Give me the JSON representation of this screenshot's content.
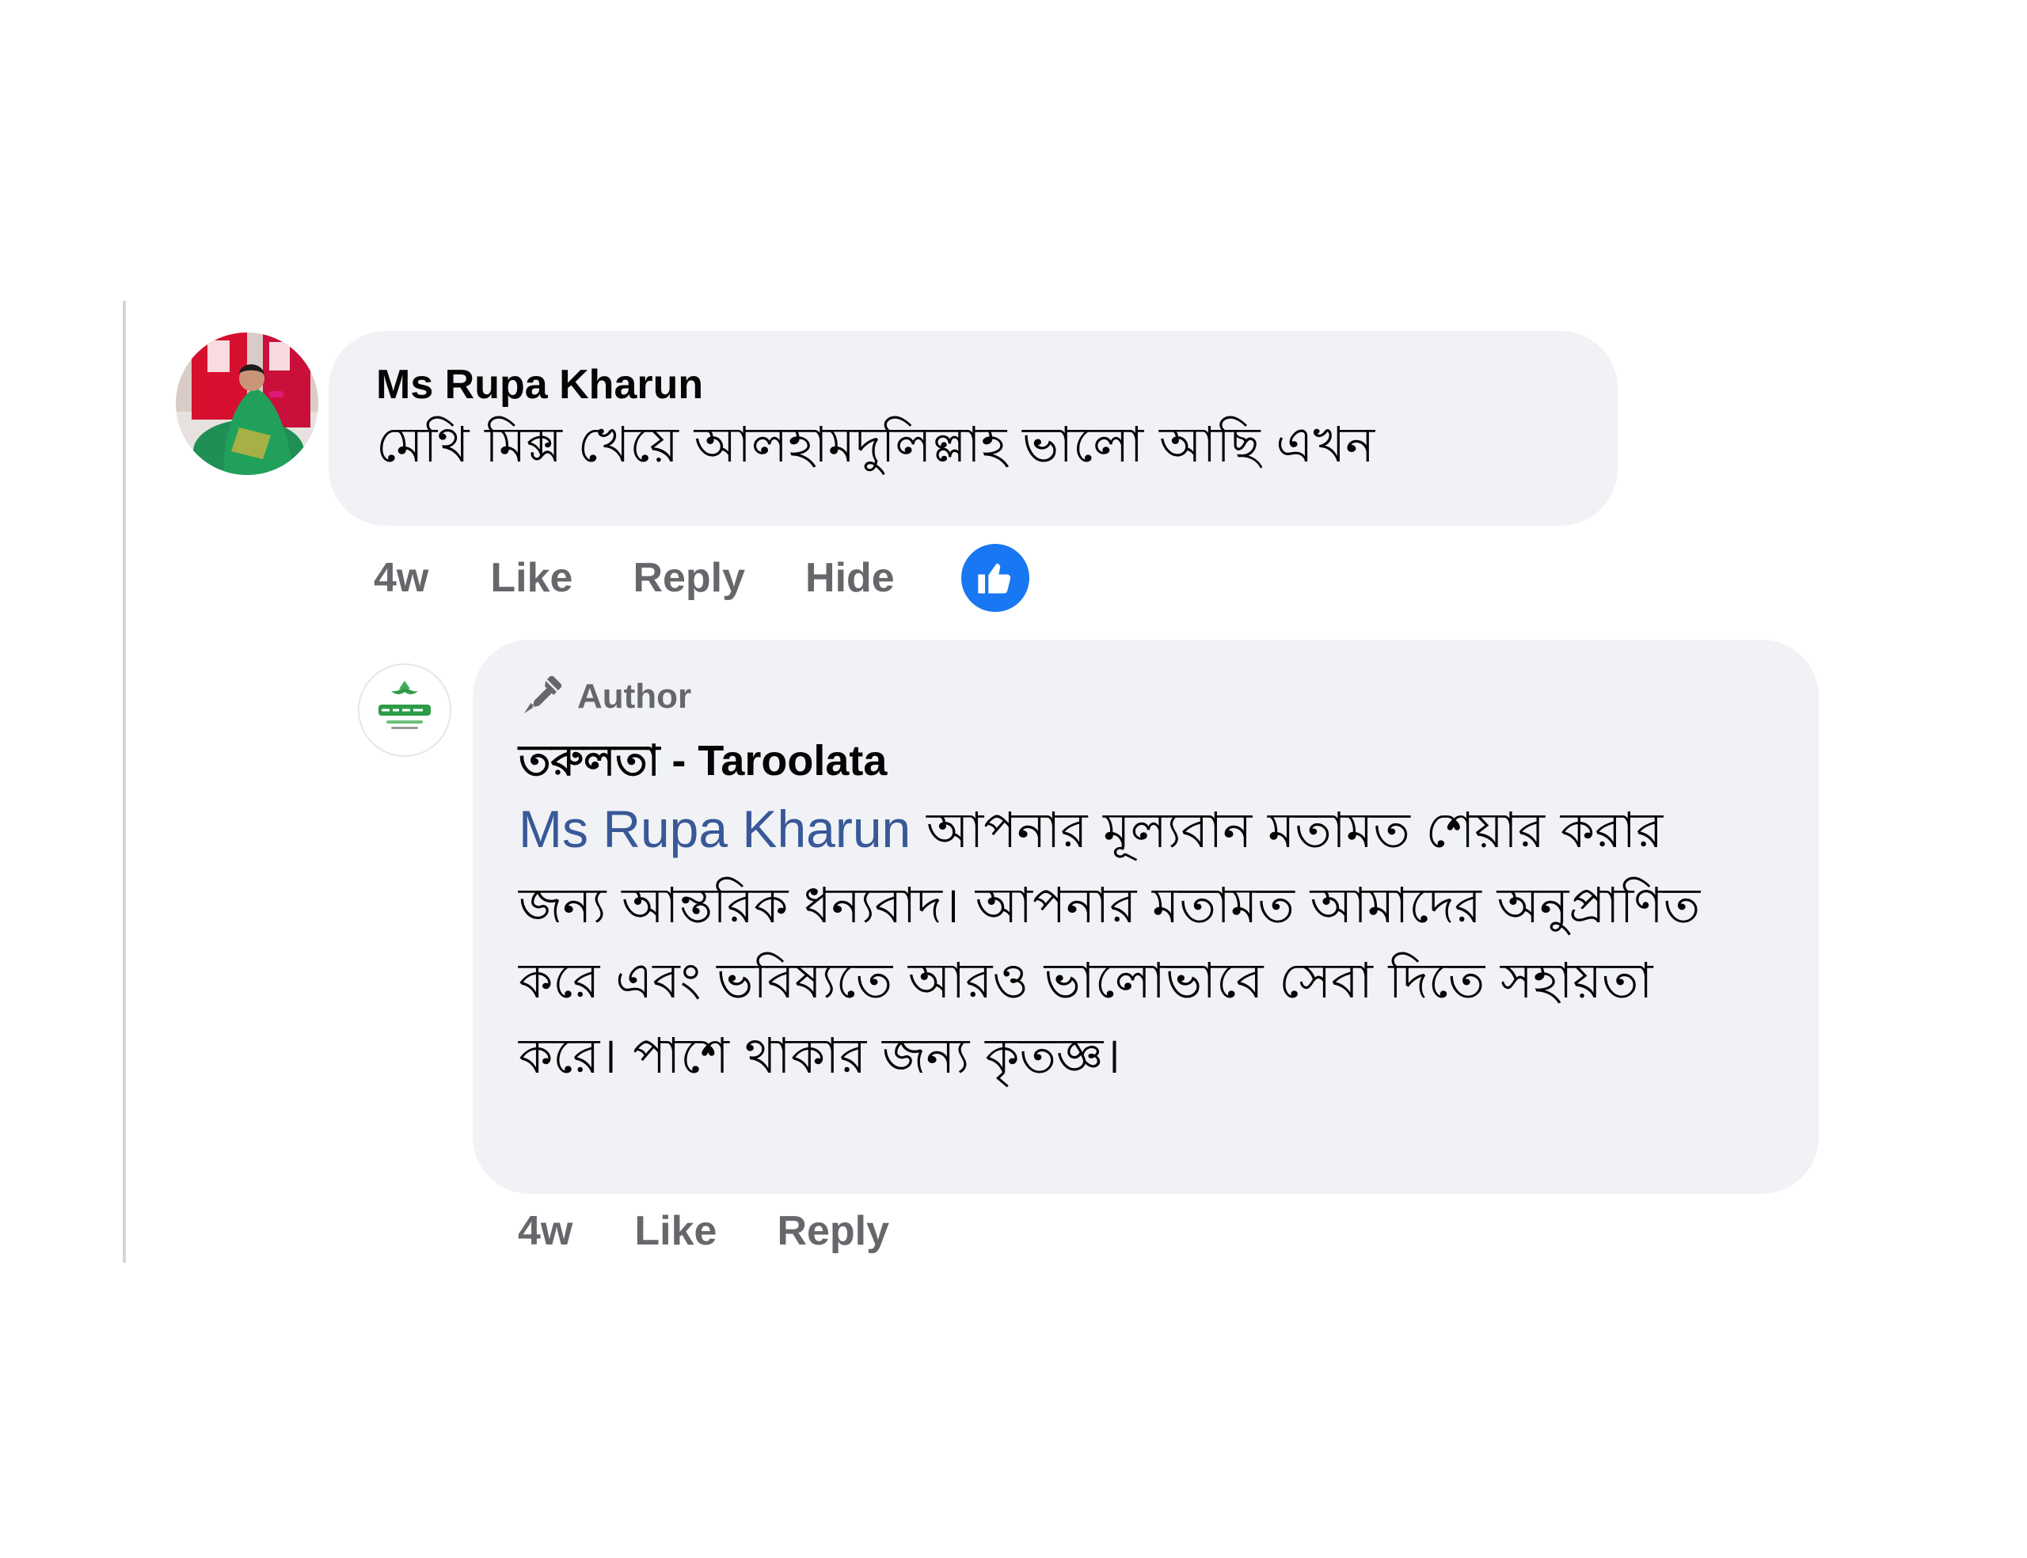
{
  "thread": {
    "comment": {
      "author": "Ms Rupa Kharun",
      "text": "মেথি মিক্স খেয়ে আলহামদুলিল্লাহ ভালো আছি এখন",
      "time": "4w",
      "actions": {
        "like": "Like",
        "reply": "Reply",
        "hide": "Hide"
      },
      "reaction_icon": "thumbs-up-icon"
    },
    "reply": {
      "badge": "Author",
      "badge_icon": "pen-icon",
      "author": "তরুলতা - Taroolata",
      "mention": "Ms Rupa Kharun",
      "text": " আপনার মূল্যবান মতামত শেয়ার করার জন্য আন্তরিক ধন্যবাদ। আপনার মতামত আমাদের অনুপ্রাণিত করে এবং ভবিষ্যতে আরও ভালোভাবে সেবা দিতে সহায়তা করে। পাশে থাকার জন্য কৃতজ্ঞ।",
      "time": "4w",
      "actions": {
        "like": "Like",
        "reply": "Reply"
      }
    }
  },
  "colors": {
    "bubble": "#f0f2f5",
    "mention": "#385898",
    "meta": "#65676b",
    "like_blue": "#1877f2"
  }
}
